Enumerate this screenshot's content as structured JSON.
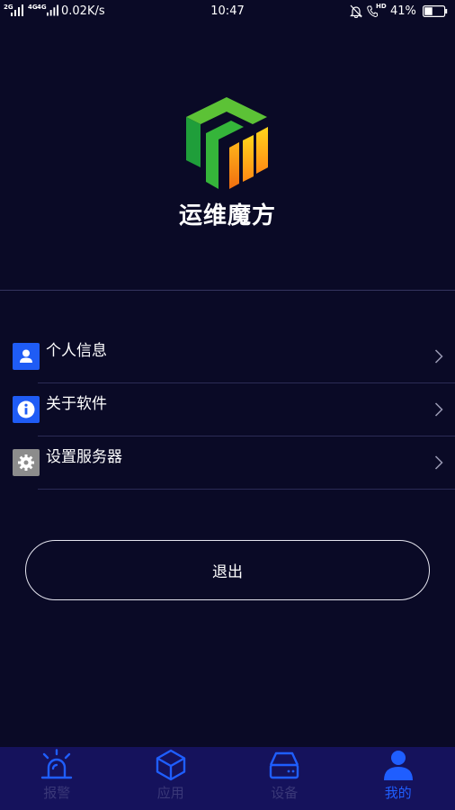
{
  "status_bar": {
    "network_2g": "2G",
    "network_4g_a": "4G",
    "network_4g_b": "4G",
    "data_speed": "0.02K/s",
    "time": "10:47",
    "hd_label": "HD",
    "battery": "41%",
    "icons": [
      "signal-bars-icon",
      "mute-bell-icon",
      "hd-call-icon",
      "battery-icon"
    ]
  },
  "header": {
    "logo_icon": "app-logo",
    "app_name": "运维魔方"
  },
  "menu": {
    "items": [
      {
        "label": "个人信息",
        "icon": "user-icon",
        "icon_bg": "#1f5cf5"
      },
      {
        "label": "关于软件",
        "icon": "info-icon",
        "icon_bg": "#1f5cf5"
      },
      {
        "label": "设置服务器",
        "icon": "gear-icon",
        "icon_bg": "#8c8c8c"
      }
    ],
    "chevron_icon": "chevron-right-icon"
  },
  "logout": {
    "label": "退出"
  },
  "tabbar": {
    "tabs": [
      {
        "label": "报警",
        "icon": "alarm-icon",
        "active": false
      },
      {
        "label": "应用",
        "icon": "cube-icon",
        "active": false
      },
      {
        "label": "设备",
        "icon": "hard-drive-icon",
        "active": false
      },
      {
        "label": "我的",
        "icon": "person-icon",
        "active": true
      }
    ]
  },
  "colors": {
    "background": "#0a0a26",
    "tabbar_bg": "#15125c",
    "accent": "#1f5eff",
    "tab_inactive_label": "#3a3878",
    "divider": "#2b2b56",
    "logo_green": "#3cb43c",
    "logo_orange": "#ff9a14"
  }
}
